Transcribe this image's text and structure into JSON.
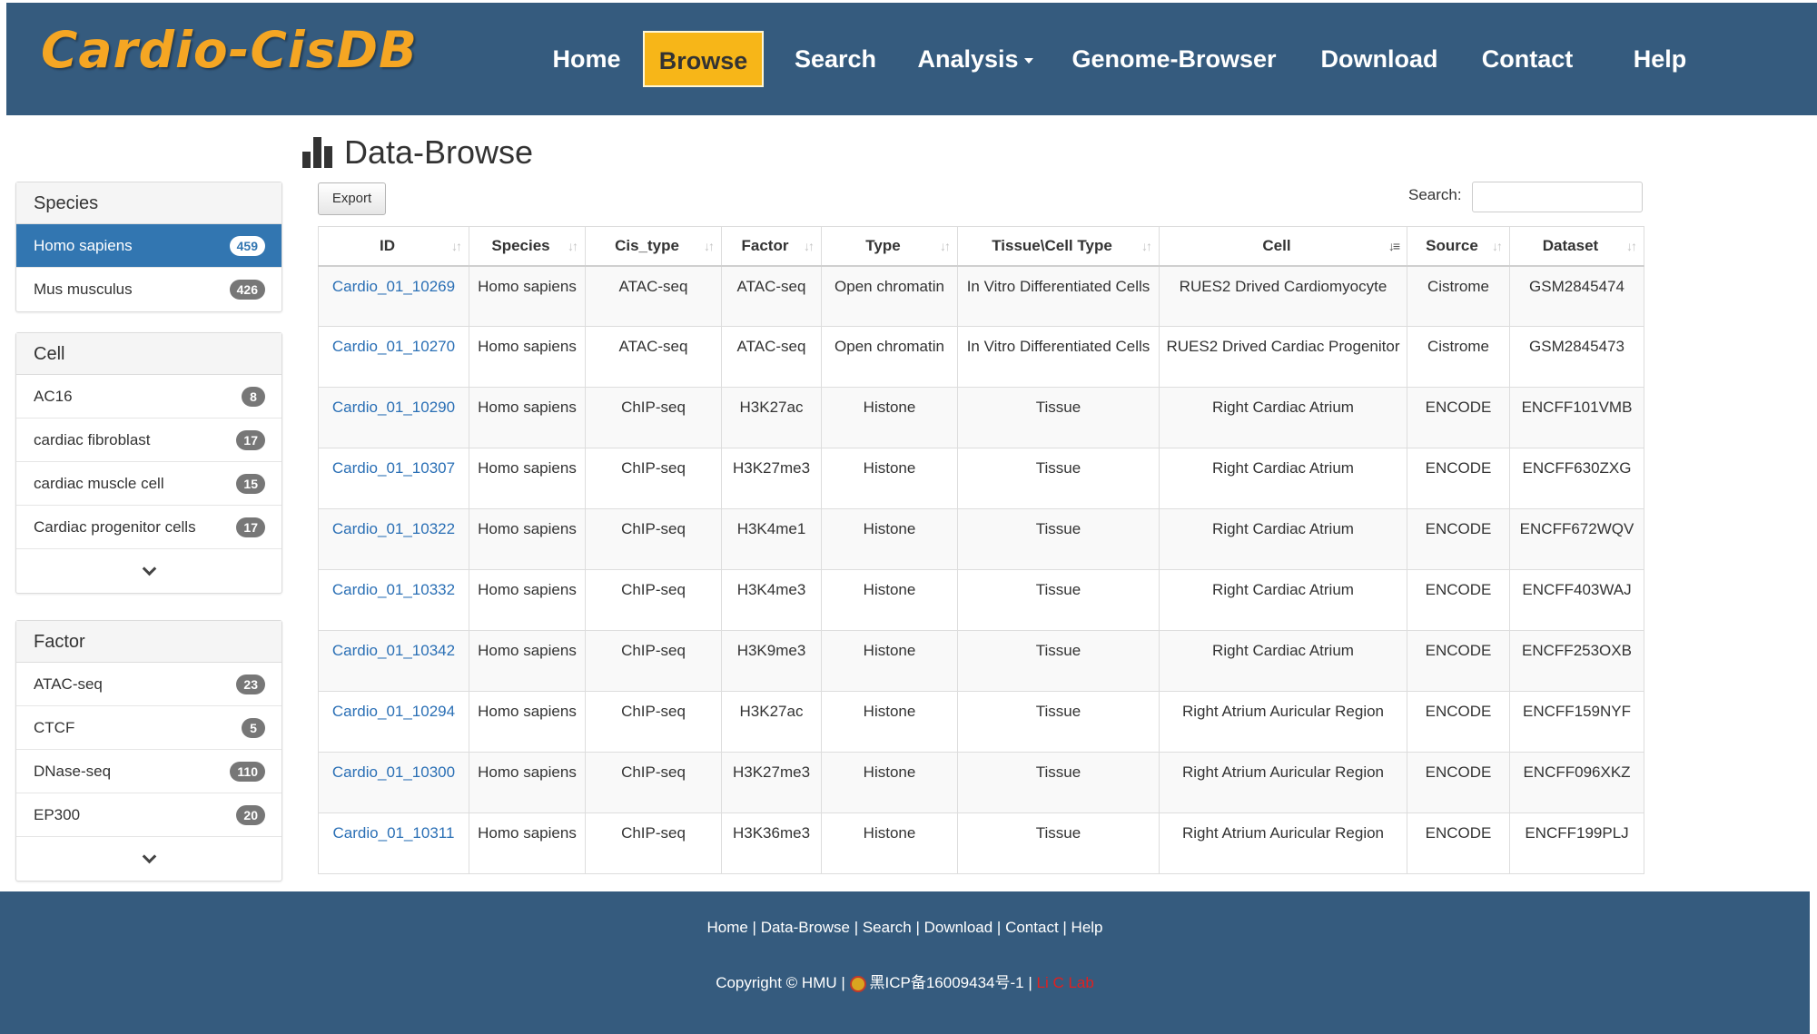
{
  "brand": "Cardio-CisDB",
  "nav": {
    "home": "Home",
    "browse": "Browse",
    "search": "Search",
    "analysis": "Analysis",
    "genome_browser": "Genome-Browser",
    "download": "Download",
    "contact": "Contact",
    "help": "Help"
  },
  "page_title": "Data-Browse",
  "sidebar": {
    "species": {
      "title": "Species",
      "items": [
        {
          "label": "Homo sapiens",
          "count": "459"
        },
        {
          "label": "Mus musculus",
          "count": "426"
        }
      ]
    },
    "cell": {
      "title": "Cell",
      "items": [
        {
          "label": "AC16",
          "count": "8"
        },
        {
          "label": "cardiac fibroblast",
          "count": "17"
        },
        {
          "label": "cardiac muscle cell",
          "count": "15"
        },
        {
          "label": "Cardiac progenitor cells",
          "count": "17"
        }
      ]
    },
    "factor": {
      "title": "Factor",
      "items": [
        {
          "label": "ATAC-seq",
          "count": "23"
        },
        {
          "label": "CTCF",
          "count": "5"
        },
        {
          "label": "DNase-seq",
          "count": "110"
        },
        {
          "label": "EP300",
          "count": "20"
        }
      ]
    }
  },
  "toolbar": {
    "export_label": "Export",
    "search_label": "Search:",
    "search_value": ""
  },
  "table": {
    "headers": [
      "ID",
      "Species",
      "Cis_type",
      "Factor",
      "Type",
      "Tissue\\Cell Type",
      "Cell",
      "Source",
      "Dataset"
    ],
    "rows": [
      [
        "Cardio_01_10269",
        "Homo sapiens",
        "ATAC-seq",
        "ATAC-seq",
        "Open chromatin",
        "In Vitro Differentiated Cells",
        "RUES2 Drived Cardiomyocyte",
        "Cistrome",
        "GSM2845474"
      ],
      [
        "Cardio_01_10270",
        "Homo sapiens",
        "ATAC-seq",
        "ATAC-seq",
        "Open chromatin",
        "In Vitro Differentiated Cells",
        "RUES2 Drived Cardiac Progenitor",
        "Cistrome",
        "GSM2845473"
      ],
      [
        "Cardio_01_10290",
        "Homo sapiens",
        "ChIP-seq",
        "H3K27ac",
        "Histone",
        "Tissue",
        "Right Cardiac Atrium",
        "ENCODE",
        "ENCFF101VMB"
      ],
      [
        "Cardio_01_10307",
        "Homo sapiens",
        "ChIP-seq",
        "H3K27me3",
        "Histone",
        "Tissue",
        "Right Cardiac Atrium",
        "ENCODE",
        "ENCFF630ZXG"
      ],
      [
        "Cardio_01_10322",
        "Homo sapiens",
        "ChIP-seq",
        "H3K4me1",
        "Histone",
        "Tissue",
        "Right Cardiac Atrium",
        "ENCODE",
        "ENCFF672WQV"
      ],
      [
        "Cardio_01_10332",
        "Homo sapiens",
        "ChIP-seq",
        "H3K4me3",
        "Histone",
        "Tissue",
        "Right Cardiac Atrium",
        "ENCODE",
        "ENCFF403WAJ"
      ],
      [
        "Cardio_01_10342",
        "Homo sapiens",
        "ChIP-seq",
        "H3K9me3",
        "Histone",
        "Tissue",
        "Right Cardiac Atrium",
        "ENCODE",
        "ENCFF253OXB"
      ],
      [
        "Cardio_01_10294",
        "Homo sapiens",
        "ChIP-seq",
        "H3K27ac",
        "Histone",
        "Tissue",
        "Right Atrium Auricular Region",
        "ENCODE",
        "ENCFF159NYF"
      ],
      [
        "Cardio_01_10300",
        "Homo sapiens",
        "ChIP-seq",
        "H3K27me3",
        "Histone",
        "Tissue",
        "Right Atrium Auricular Region",
        "ENCODE",
        "ENCFF096XKZ"
      ],
      [
        "Cardio_01_10311",
        "Homo sapiens",
        "ChIP-seq",
        "H3K36me3",
        "Histone",
        "Tissue",
        "Right Atrium Auricular Region",
        "ENCODE",
        "ENCFF199PLJ"
      ]
    ]
  },
  "footer": {
    "links": [
      "Home",
      "Data-Browse",
      "Search",
      "Download",
      "Contact",
      "Help"
    ],
    "copyright": "Copyright © HMU |",
    "icp": "黑ICP备16009434号-1 |",
    "lab": "Li C Lab"
  },
  "colors": {
    "navbar": "#355b7e",
    "brand": "#f5a623",
    "active_nav": "#f7b618",
    "active_item": "#3276b1",
    "link": "#2a6fb5"
  }
}
